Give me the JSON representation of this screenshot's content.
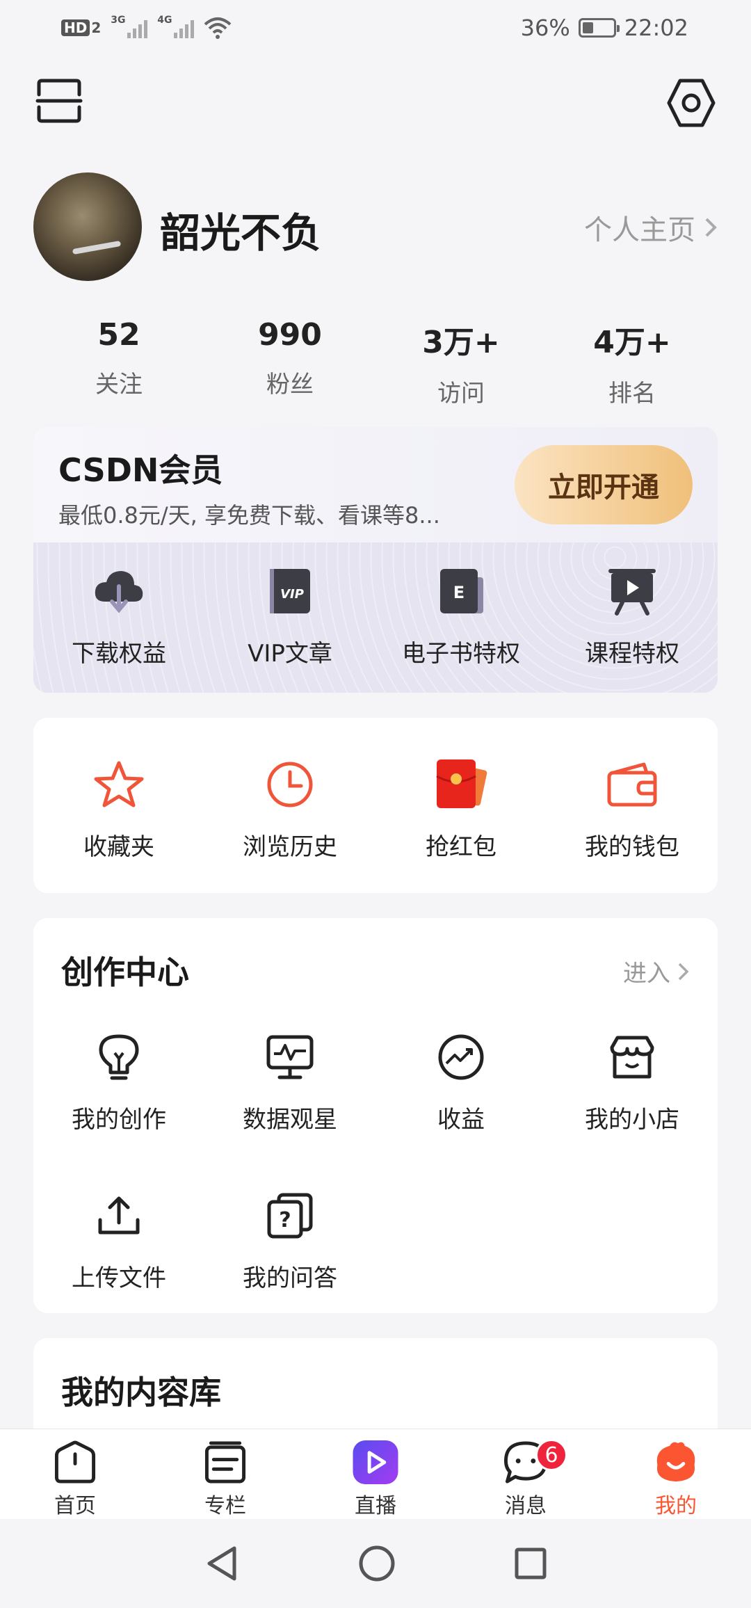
{
  "status_bar": {
    "hd_label": "HD",
    "hd_sub": "2",
    "signal1_label": "3G",
    "signal2_label": "4G",
    "battery_pct": "36%",
    "battery_level": 0.36,
    "time": "22:02"
  },
  "profile": {
    "username": "韶光不负",
    "homepage_link": "个人主页"
  },
  "stats": [
    {
      "value": "52",
      "label": "关注"
    },
    {
      "value": "990",
      "label": "粉丝"
    },
    {
      "value": "3万+",
      "label": "访问"
    },
    {
      "value": "4万+",
      "label": "排名"
    }
  ],
  "vip": {
    "title": "CSDN会员",
    "desc": "最低0.8元/天, 享免费下载、看课等8...",
    "button": "立即开通",
    "perks": [
      {
        "label": "下载权益",
        "icon": "cloud-download-icon"
      },
      {
        "label": "VIP文章",
        "icon": "vip-article-icon"
      },
      {
        "label": "电子书特权",
        "icon": "ebook-icon"
      },
      {
        "label": "课程特权",
        "icon": "course-icon"
      }
    ]
  },
  "quick": [
    {
      "label": "收藏夹",
      "icon": "star-icon"
    },
    {
      "label": "浏览历史",
      "icon": "clock-icon"
    },
    {
      "label": "抢红包",
      "icon": "red-packet-icon"
    },
    {
      "label": "我的钱包",
      "icon": "wallet-icon"
    }
  ],
  "creator": {
    "title": "创作中心",
    "enter": "进入",
    "items": [
      {
        "label": "我的创作",
        "icon": "lightbulb-icon"
      },
      {
        "label": "数据观星",
        "icon": "monitor-chart-icon"
      },
      {
        "label": "收益",
        "icon": "earnings-icon"
      },
      {
        "label": "我的小店",
        "icon": "shop-icon"
      },
      {
        "label": "上传文件",
        "icon": "upload-icon"
      },
      {
        "label": "我的问答",
        "icon": "qa-icon"
      }
    ]
  },
  "library": {
    "title": "我的内容库"
  },
  "tabs": [
    {
      "label": "首页"
    },
    {
      "label": "专栏"
    },
    {
      "label": "直播"
    },
    {
      "label": "消息",
      "badge": "6"
    },
    {
      "label": "我的"
    }
  ],
  "colors": {
    "accent": "#fc5531",
    "badge": "#f0233c",
    "vip_button": "#f0c07a"
  }
}
